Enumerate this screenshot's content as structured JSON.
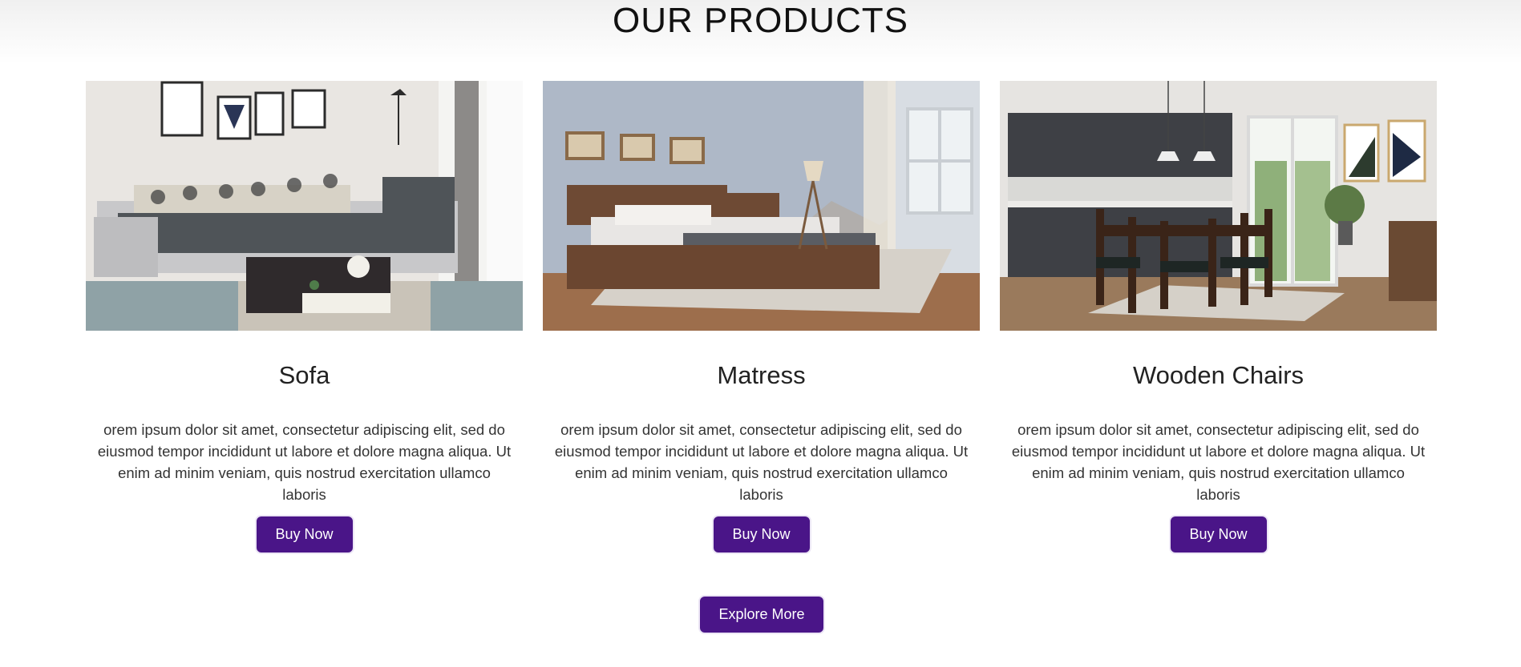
{
  "section": {
    "title": "OUR PRODUCTS"
  },
  "products": [
    {
      "image": "sofa-living-room-photo",
      "name": "Sofa",
      "description": "orem ipsum dolor sit amet, consectetur adipiscing elit, sed do eiusmod tempor incididunt ut labore et dolore magna aliqua. Ut enim ad minim veniam, quis nostrud exercitation ullamco laboris",
      "button": "Buy Now"
    },
    {
      "image": "bed-bedroom-photo",
      "name": "Matress",
      "description": "orem ipsum dolor sit amet, consectetur adipiscing elit, sed do eiusmod tempor incididunt ut labore et dolore magna aliqua. Ut enim ad minim veniam, quis nostrud exercitation ullamco laboris",
      "button": "Buy Now"
    },
    {
      "image": "dining-chairs-kitchen-photo",
      "name": "Wooden Chairs",
      "description": "orem ipsum dolor sit amet, consectetur adipiscing elit, sed do eiusmod tempor incididunt ut labore et dolore magna aliqua. Ut enim ad minim veniam, quis nostrud exercitation ullamco laboris",
      "button": "Buy Now"
    }
  ],
  "explore": {
    "label": "Explore More"
  },
  "colors": {
    "button": "#4a1588",
    "button_text": "#ffffff",
    "title": "#111111"
  }
}
